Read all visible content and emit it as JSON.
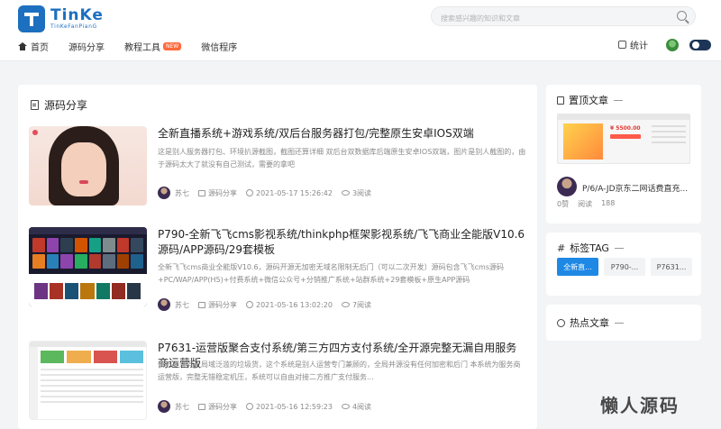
{
  "header": {
    "logo_title": "TinKe",
    "logo_sub": "TinKeFanPianG",
    "search_placeholder": "搜索感兴趣的知识和文章"
  },
  "nav": {
    "items": [
      {
        "label": "首页"
      },
      {
        "label": "源码分享"
      },
      {
        "label": "教程工具",
        "badge": "NEW"
      },
      {
        "label": "微信程序"
      }
    ],
    "stats_label": "统计"
  },
  "main": {
    "section_title": "源码分享",
    "posts": [
      {
        "title": "全新直播系统+游戏系统/双后台服务器打包/完整原生安卓IOS双端",
        "excerpt": "这是别人服务器打包、环境扒源截图，截图还算详细 双后台双数据库后端原生安卓IOS双端，图片是别人截图的，由于源码太大了就没有自己测试，需要的拿吧",
        "author": "苏七",
        "category": "源码分享",
        "date": "2021-05-17 15:26:42",
        "views": "3阅读"
      },
      {
        "title": "P790-全新飞飞cms影视系统/thinkphp框架影视系统/飞飞商业全能版V10.6源码/APP源码/29套模板",
        "excerpt": "全新飞飞cms商业全能版V10.6，源码开源无加密无域名限制无后门（可以二次开发）源码包含飞飞cms源码+PC/WAP/APP(H5)+付费系统+微信公众号+分销推广系统+站群系统+29套模板+原生APP源码",
        "author": "苏七",
        "category": "源码分享",
        "date": "2021-05-16 13:02:20",
        "views": "7阅读"
      },
      {
        "title": "P7631-运营版聚合支付系统/第三方四方支付系统/全开源完整无漏自用服务商运营版",
        "excerpt": "请不要乘同上局域泛滥的垃圾货，这个系统是别人运营专门兼顾的，全局并源没有任何加密和后门 本系统为服务商运营版，完整无错稳定机压，系统可以自由对接二方推广支付服务...",
        "author": "苏七",
        "category": "源码分享",
        "date": "2021-05-16 12:59:23",
        "views": "4阅读"
      }
    ]
  },
  "sidebar": {
    "top_posts": {
      "heading": "置顶文章",
      "thumb_price": "¥ 5500.00",
      "title": "P/6/A-JD京东二网话费直充...",
      "likes": "0赞",
      "views": "阅读",
      "count": "188"
    },
    "tags": {
      "heading": "标签TAG",
      "items": [
        "全新直...",
        "P790-...",
        "P7631..."
      ]
    },
    "hot": {
      "heading": "热点文章"
    }
  },
  "watermark": "懒人源码"
}
